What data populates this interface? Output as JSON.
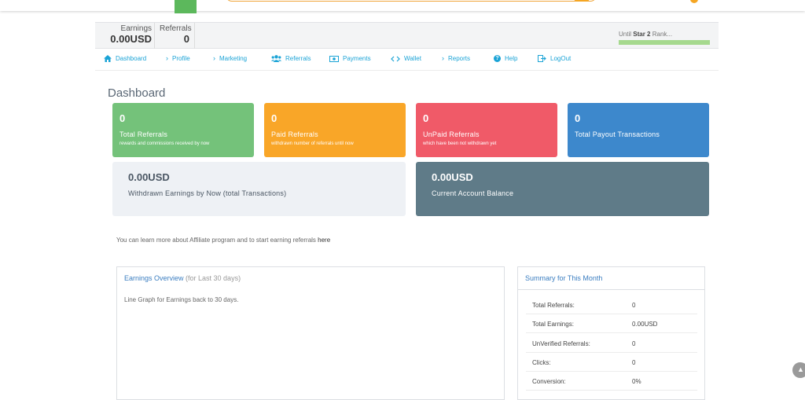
{
  "stats": {
    "earnings_label": "Earnings",
    "earnings_value": "0.00USD",
    "referrals_label": "Referrals",
    "referrals_value": "0"
  },
  "rank": {
    "prefix": "Until",
    "name": "Star 2",
    "suffix": "Rank...",
    "progress_color": "#a6d98e"
  },
  "nav": {
    "items": [
      {
        "label": "Dashboard",
        "icon": "home-icon"
      },
      {
        "label": "Profile",
        "icon": "chevron-right-icon"
      },
      {
        "label": "Marketing",
        "icon": "chevron-right-icon"
      },
      {
        "label": "Referrals",
        "icon": "users-icon"
      },
      {
        "label": "Payments",
        "icon": "money-icon"
      },
      {
        "label": "Wallet",
        "icon": "code-icon"
      },
      {
        "label": "Reports",
        "icon": "chevron-right-icon"
      },
      {
        "label": "Help",
        "icon": "question-circle-icon"
      },
      {
        "label": "LogOut",
        "icon": "logout-icon"
      }
    ]
  },
  "page_title": "Dashboard",
  "cards": [
    {
      "value": "0",
      "title": "Total Referrals",
      "subtitle": "rewards and commissions received by now",
      "color": "#74c27a"
    },
    {
      "value": "0",
      "title": "Paid Referrals",
      "subtitle": "withdrawn number of referrals until now",
      "color": "#f9a628"
    },
    {
      "value": "0",
      "title": "UnPaid Referrals",
      "subtitle": "which have been not withdrawn yet",
      "color": "#f05a68"
    },
    {
      "value": "0",
      "title": "Total Payout Transactions",
      "subtitle": "",
      "color": "#3d88cc"
    }
  ],
  "wide_cards": [
    {
      "value": "0.00USD",
      "title": "Withdrawn Earnings by Now (total Transactions)",
      "color": "#eef1f5"
    },
    {
      "value": "0.00USD",
      "title": "Current Account Balance",
      "color": "#5f7b88"
    }
  ],
  "info": {
    "text": "You can learn more about Affiliate program and to start earning referrals ",
    "link": "here"
  },
  "earnings_panel": {
    "title": "Earnings Overview",
    "title_suffix": " (for Last 30 days)",
    "description": "Line Graph for Earnings back to 30 days."
  },
  "summary_panel": {
    "title": "Summary for This Month",
    "rows": [
      {
        "label": "Total Referrals:",
        "value": "0"
      },
      {
        "label": "Total Earnings:",
        "value": "0.00USD"
      },
      {
        "label": "UnVerified Referrals:",
        "value": "0"
      },
      {
        "label": "Clicks:",
        "value": "0"
      },
      {
        "label": "Conversion:",
        "value": "0%"
      }
    ]
  }
}
